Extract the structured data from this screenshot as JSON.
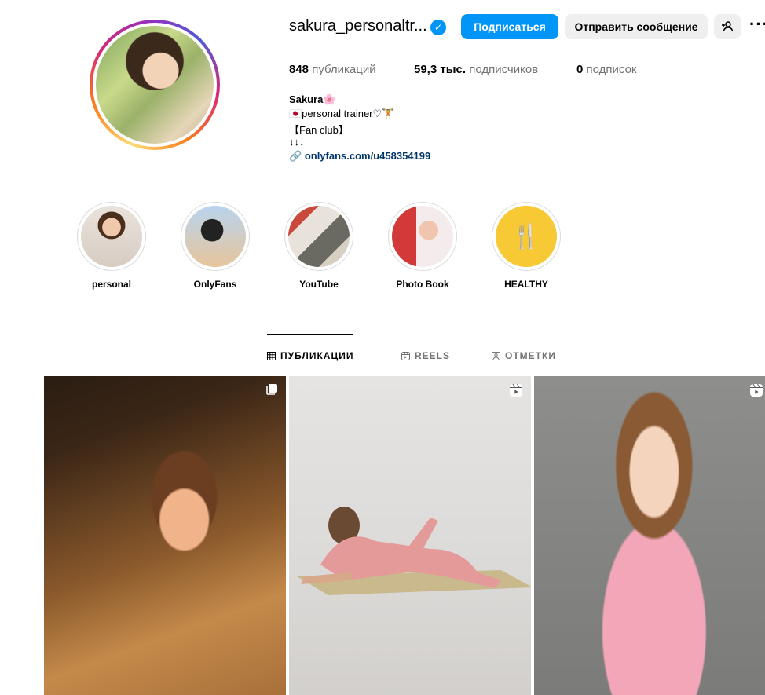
{
  "profile": {
    "username": "sakura_personaltr...",
    "verified_icon": "verified-badge-icon",
    "buttons": {
      "follow": "Подписаться",
      "message": "Отправить сообщение"
    },
    "stats": {
      "posts_count": "848",
      "posts_label": "публикаций",
      "followers_count": "59,3 тыс.",
      "followers_label": "подписчиков",
      "following_count": "0",
      "following_label": "подписок"
    },
    "bio": {
      "name": "Sakura🌸",
      "line1": "🇯🇵personal trainer♡🏋️",
      "line2": "【Fan club】",
      "line3": "↓↓↓",
      "link": "onlyfans.com/u458354199"
    }
  },
  "highlights": [
    {
      "label": "personal"
    },
    {
      "label": "OnlyFans"
    },
    {
      "label": "YouTube"
    },
    {
      "label": "Photo Book"
    },
    {
      "label": "HEALTHY",
      "icon": "🍴"
    }
  ],
  "tabs": [
    {
      "label": "ПУБЛИКАЦИИ",
      "icon": "grid-icon",
      "active": true
    },
    {
      "label": "REELS",
      "icon": "reels-icon",
      "active": false
    },
    {
      "label": "ОТМЕТКИ",
      "icon": "tagged-icon",
      "active": false
    }
  ],
  "posts": [
    {
      "type": "carousel",
      "icon": "carousel-icon"
    },
    {
      "type": "reel",
      "icon": "reels-icon"
    },
    {
      "type": "reel",
      "icon": "reels-icon"
    }
  ],
  "colors": {
    "accent": "#0095f6",
    "link": "#00376b",
    "secondary_text": "#737373"
  }
}
